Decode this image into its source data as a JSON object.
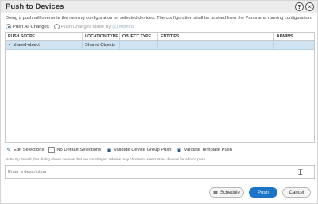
{
  "dialog": {
    "title": "Push to Devices",
    "help_icon": "?",
    "close_icon": "✕"
  },
  "notice": "Doing a push will overwrite the running configuration on selected devices. The configuration shall be pushed from the Panorama running configuration.",
  "push_mode": {
    "option_all": "Push All Changes",
    "option_by": "Push Changes Made By",
    "option_by_link": "(1) Admins",
    "selected": "Push All Changes"
  },
  "grid": {
    "columns": [
      "PUSH SCOPE",
      "LOCATION TYPE",
      "OBJECT TYPE",
      "ENTITIES",
      "ADMINS"
    ],
    "rows": [
      {
        "scope": "shared-object",
        "location_type": "Shared Objects",
        "object_type": "",
        "entities": "",
        "admins": ""
      }
    ]
  },
  "toolbar": {
    "edit_selections": "Edit Selections",
    "no_default_selections": "No Default Selections",
    "validate_device_group_push": "Validate Device Group Push",
    "validate_template_push": "Validate Template Push"
  },
  "note": "Note: By default, this dialog shows devices that are out of sync. Admins may choose to select other devices for a force push.",
  "description": {
    "placeholder": "Enter a description",
    "value": ""
  },
  "footer": {
    "schedule_label": "Schedule",
    "push_label": "Push",
    "cancel_label": "Cancel"
  },
  "colors": {
    "primary": "#1b74c5",
    "selected_row": "#cfe3f2"
  }
}
